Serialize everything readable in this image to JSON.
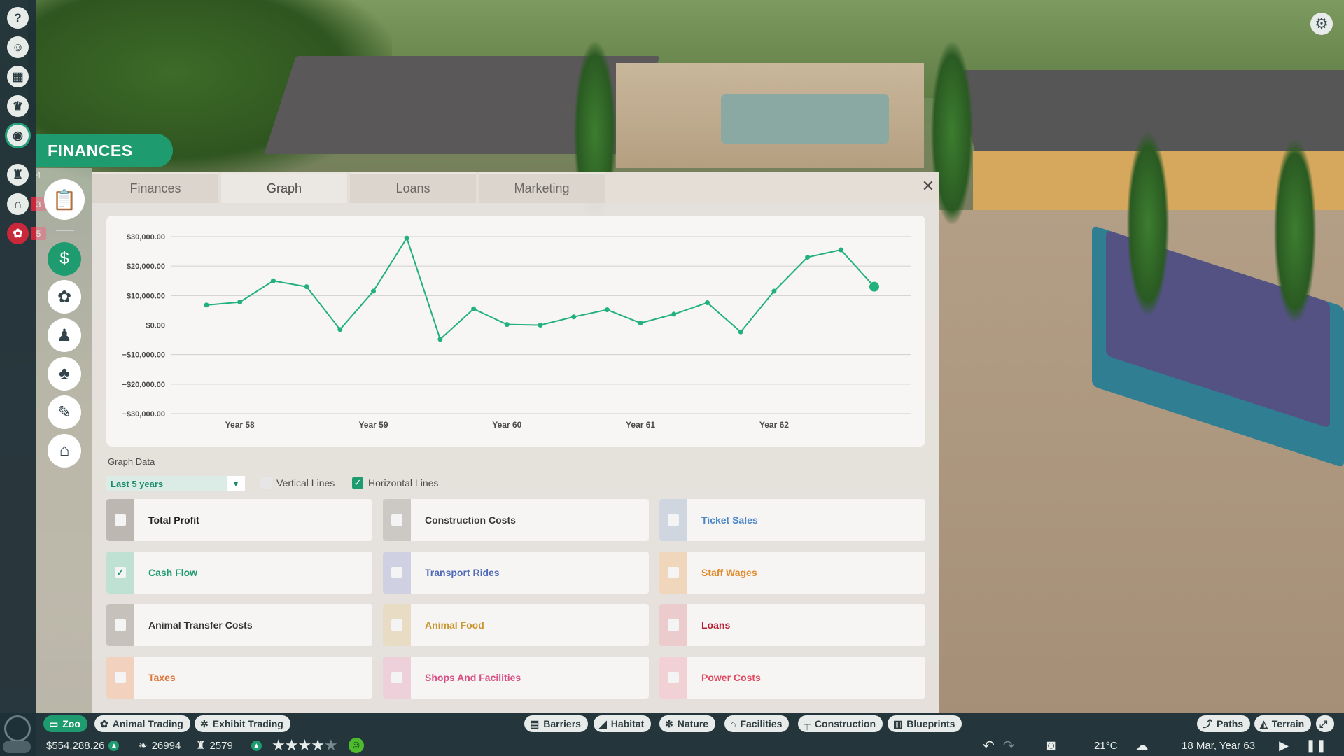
{
  "finances_title": "FINANCES",
  "tabs": [
    {
      "label": "Finances",
      "active": false
    },
    {
      "label": "Graph",
      "active": true
    },
    {
      "label": "Loans",
      "active": false
    },
    {
      "label": "Marketing",
      "active": false
    }
  ],
  "left_strip": {
    "icons": [
      "help-icon",
      "zookeeper-icon",
      "calendar-icon",
      "trophy-icon",
      "view-eye-icon",
      "research-icon",
      "habitat-gate-icon",
      "paw-alert-icon"
    ],
    "badges": {
      "research": "4",
      "habitat": "3",
      "paw": "5"
    }
  },
  "sub_sidebar": {
    "icons": [
      "clipboard-icon",
      "finances-icon",
      "animals-paw-icon",
      "staff-icon",
      "species-icon",
      "maintenance-icon",
      "shop-icon"
    ]
  },
  "chart_data": {
    "type": "line",
    "y_ticks": [
      "$30,000.00",
      "$20,000.00",
      "$10,000.00",
      "$0.00",
      "−$10,000.00",
      "−$20,000.00",
      "−$30,000.00"
    ],
    "ylim": [
      -30000,
      30000
    ],
    "x_ticks": [
      "Year 58",
      "Year 59",
      "Year 60",
      "Year 61",
      "Year 62"
    ],
    "grid": {
      "horizontal": true,
      "vertical": false
    },
    "series": [
      {
        "color": "#22b07d",
        "values": [
          6800,
          7800,
          15000,
          13000,
          -1500,
          11500,
          29500,
          -4800,
          5500,
          200,
          0,
          2800,
          5200,
          700,
          3700,
          7600,
          -2300,
          11500,
          23000,
          25500,
          13000
        ]
      }
    ]
  },
  "graph_data": {
    "label": "Graph Data",
    "range": "Last 5 years",
    "vertical_lines": {
      "label": "Vertical Lines",
      "checked": false
    },
    "horizontal_lines": {
      "label": "Horizontal Lines",
      "checked": true
    }
  },
  "datasets": [
    {
      "label": "Total Profit",
      "checked": false,
      "color": "#222222",
      "box": "#bdb7b2"
    },
    {
      "label": "Construction Costs",
      "checked": false,
      "color": "#3a3a3a",
      "box": "#ccc8c4"
    },
    {
      "label": "Ticket Sales",
      "checked": false,
      "color": "#4a86c8",
      "box": "#cfd6e0"
    },
    {
      "label": "Cash Flow",
      "checked": true,
      "color": "#1e9b6f",
      "box": "#bfe1d3"
    },
    {
      "label": "Transport Rides",
      "checked": false,
      "color": "#4f6bb8",
      "box": "#cfd1e2"
    },
    {
      "label": "Staff Wages",
      "checked": false,
      "color": "#e28a2a",
      "box": "#f0d6bb"
    },
    {
      "label": "Animal Transfer Costs",
      "checked": false,
      "color": "#333333",
      "box": "#c7c1bc"
    },
    {
      "label": "Animal Food",
      "checked": false,
      "color": "#c8962f",
      "box": "#e8dcc4"
    },
    {
      "label": "Loans",
      "checked": false,
      "color": "#b81f33",
      "box": "#eccbcc"
    },
    {
      "label": "Taxes",
      "checked": false,
      "color": "#e07438",
      "box": "#f2d2bf"
    },
    {
      "label": "Shops And Facilities",
      "checked": false,
      "color": "#d64f85",
      "box": "#eed0db"
    },
    {
      "label": "Power Costs",
      "checked": false,
      "color": "#e04860",
      "box": "#f1d1d4"
    }
  ],
  "bottom_left_tabs": [
    {
      "label": "Zoo",
      "icon": "zoo-sign-icon",
      "active": true
    },
    {
      "label": "Animal Trading",
      "icon": "paw-trade-icon",
      "active": false
    },
    {
      "label": "Exhibit Trading",
      "icon": "exhibit-icon",
      "active": false
    }
  ],
  "bottom_build_tabs": [
    {
      "label": "Barriers",
      "icon": "barrier-icon"
    },
    {
      "label": "Habitat",
      "icon": "habitat-icon"
    },
    {
      "label": "Nature",
      "icon": "nature-icon"
    },
    {
      "label": "Facilities",
      "icon": "facilities-icon"
    },
    {
      "label": "Construction",
      "icon": "construction-icon"
    },
    {
      "label": "Blueprints",
      "icon": "blueprints-icon"
    }
  ],
  "bottom_right_tabs": [
    {
      "label": "Paths",
      "icon": "paths-icon"
    },
    {
      "label": "Terrain",
      "icon": "terrain-icon"
    }
  ],
  "status": {
    "money": "$554,288.26",
    "conservation": "26994",
    "guests": "2579",
    "rating_stars": 4,
    "rating_max": 5,
    "temperature": "21°C",
    "date": "18 Mar, Year 63"
  }
}
